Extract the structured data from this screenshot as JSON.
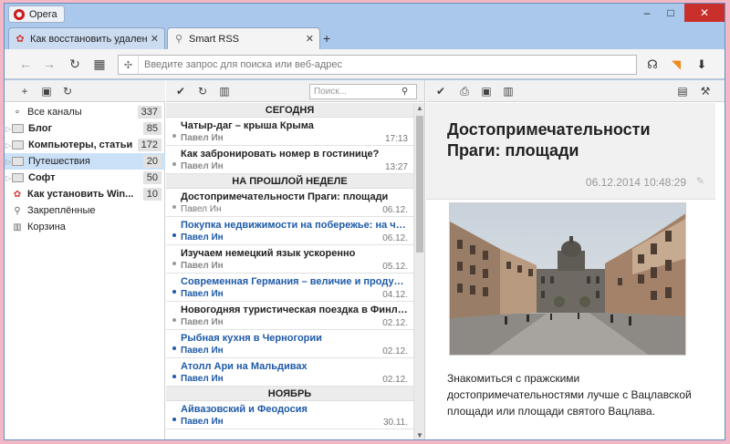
{
  "browser": {
    "menu_label": "Opera",
    "window_controls": {
      "minimize": "‒",
      "maximize": "□",
      "close": "✕"
    },
    "tabs": [
      {
        "label": "Как восстановить удален",
        "icon": "puzzle-icon",
        "active": false
      },
      {
        "label": "Smart RSS",
        "icon": "rss-icon",
        "active": true
      }
    ],
    "new_tab": "+",
    "address": {
      "placeholder": "Введите запрос для поиска или веб-адрес",
      "value": ""
    }
  },
  "sidebar": {
    "feeds": [
      {
        "label": "Все каналы",
        "count": "337",
        "kind": "rss",
        "bold": false
      },
      {
        "label": "Блог",
        "count": "85",
        "kind": "folder",
        "bold": true
      },
      {
        "label": "Компьютеры, статьи",
        "count": "172",
        "kind": "folder",
        "bold": true
      },
      {
        "label": "Путешествия",
        "count": "20",
        "kind": "folder",
        "bold": false,
        "selected": true
      },
      {
        "label": "Софт",
        "count": "50",
        "kind": "folder",
        "bold": true
      },
      {
        "label": "Как установить Win...",
        "count": "10",
        "kind": "puzzle",
        "bold": true
      },
      {
        "label": "Закреплённые",
        "count": "",
        "kind": "pin",
        "bold": false
      },
      {
        "label": "Корзина",
        "count": "",
        "kind": "trash",
        "bold": false
      }
    ]
  },
  "list": {
    "search_placeholder": "Поиск...",
    "groups": [
      {
        "title": "СЕГОДНЯ",
        "items": [
          {
            "title": "Чатыр-даг – крыша Крыма",
            "author": "Павел Ин",
            "date": "17:13",
            "state": "read"
          },
          {
            "title": "Как забронировать номер в гостинице?",
            "author": "Павел Ин",
            "date": "13:27",
            "state": "read"
          }
        ]
      },
      {
        "title": "НА ПРОШЛОЙ НЕДЕЛЕ",
        "items": [
          {
            "title": "Достопримечательности Праги: площади",
            "author": "Павел Ин",
            "date": "06.12.",
            "state": "selected"
          },
          {
            "title": "Покупка недвижимости на побережье: на что о...",
            "author": "Павел Ин",
            "date": "06.12.",
            "state": "unread"
          },
          {
            "title": "Изучаем немецкий язык ускоренно",
            "author": "Павел Ин",
            "date": "05.12.",
            "state": "read"
          },
          {
            "title": "Современная Германия – величие и продуман...",
            "author": "Павел Ин",
            "date": "04.12.",
            "state": "unread"
          },
          {
            "title": "Новогодняя туристическая поездка в Финляндию",
            "author": "Павел Ин",
            "date": "02.12.",
            "state": "read"
          },
          {
            "title": "Рыбная кухня в Черногории",
            "author": "Павел Ин",
            "date": "02.12.",
            "state": "unread"
          },
          {
            "title": "Атолл Ари на Мальдивах",
            "author": "Павел Ин",
            "date": "02.12.",
            "state": "unread"
          }
        ]
      },
      {
        "title": "НОЯБРЬ",
        "items": [
          {
            "title": "Айвазовский и Феодосия",
            "author": "Павел Ин",
            "date": "30.11.",
            "state": "unread"
          }
        ]
      }
    ]
  },
  "reader": {
    "title": "Достопримечательности Праги: площади",
    "date": "06.12.2014 10:48:29",
    "body": "Знакомиться с пражскими достопримечательностями лучше с Вацлавской площади или площади святого Вацлава."
  },
  "colors": {
    "accent": "#1e88e5",
    "unread": "#1e5aa8",
    "frame": "#a9c8ec",
    "close": "#c9302c"
  }
}
